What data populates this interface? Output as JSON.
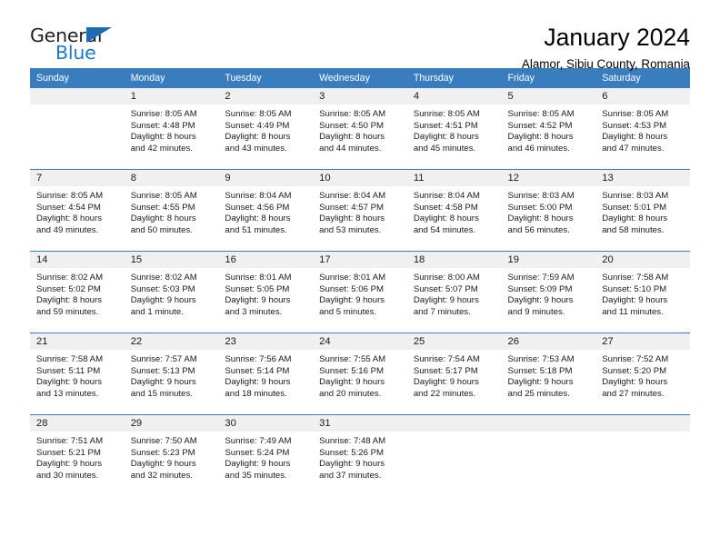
{
  "brand": {
    "name_part1": "General",
    "name_part2": "Blue",
    "accent_color": "#1f77c2",
    "header_color": "#3a7dbf"
  },
  "header": {
    "title": "January 2024",
    "subtitle": "Alamor, Sibiu County, Romania"
  },
  "weekday_headers": [
    "Sunday",
    "Monday",
    "Tuesday",
    "Wednesday",
    "Thursday",
    "Friday",
    "Saturday"
  ],
  "weeks": [
    [
      {
        "day": "",
        "sunrise": "",
        "sunset": "",
        "daylight_line1": "",
        "daylight_line2": "",
        "empty": true
      },
      {
        "day": "1",
        "sunrise": "Sunrise: 8:05 AM",
        "sunset": "Sunset: 4:48 PM",
        "daylight_line1": "Daylight: 8 hours",
        "daylight_line2": "and 42 minutes."
      },
      {
        "day": "2",
        "sunrise": "Sunrise: 8:05 AM",
        "sunset": "Sunset: 4:49 PM",
        "daylight_line1": "Daylight: 8 hours",
        "daylight_line2": "and 43 minutes."
      },
      {
        "day": "3",
        "sunrise": "Sunrise: 8:05 AM",
        "sunset": "Sunset: 4:50 PM",
        "daylight_line1": "Daylight: 8 hours",
        "daylight_line2": "and 44 minutes."
      },
      {
        "day": "4",
        "sunrise": "Sunrise: 8:05 AM",
        "sunset": "Sunset: 4:51 PM",
        "daylight_line1": "Daylight: 8 hours",
        "daylight_line2": "and 45 minutes."
      },
      {
        "day": "5",
        "sunrise": "Sunrise: 8:05 AM",
        "sunset": "Sunset: 4:52 PM",
        "daylight_line1": "Daylight: 8 hours",
        "daylight_line2": "and 46 minutes."
      },
      {
        "day": "6",
        "sunrise": "Sunrise: 8:05 AM",
        "sunset": "Sunset: 4:53 PM",
        "daylight_line1": "Daylight: 8 hours",
        "daylight_line2": "and 47 minutes."
      }
    ],
    [
      {
        "day": "7",
        "sunrise": "Sunrise: 8:05 AM",
        "sunset": "Sunset: 4:54 PM",
        "daylight_line1": "Daylight: 8 hours",
        "daylight_line2": "and 49 minutes."
      },
      {
        "day": "8",
        "sunrise": "Sunrise: 8:05 AM",
        "sunset": "Sunset: 4:55 PM",
        "daylight_line1": "Daylight: 8 hours",
        "daylight_line2": "and 50 minutes."
      },
      {
        "day": "9",
        "sunrise": "Sunrise: 8:04 AM",
        "sunset": "Sunset: 4:56 PM",
        "daylight_line1": "Daylight: 8 hours",
        "daylight_line2": "and 51 minutes."
      },
      {
        "day": "10",
        "sunrise": "Sunrise: 8:04 AM",
        "sunset": "Sunset: 4:57 PM",
        "daylight_line1": "Daylight: 8 hours",
        "daylight_line2": "and 53 minutes."
      },
      {
        "day": "11",
        "sunrise": "Sunrise: 8:04 AM",
        "sunset": "Sunset: 4:58 PM",
        "daylight_line1": "Daylight: 8 hours",
        "daylight_line2": "and 54 minutes."
      },
      {
        "day": "12",
        "sunrise": "Sunrise: 8:03 AM",
        "sunset": "Sunset: 5:00 PM",
        "daylight_line1": "Daylight: 8 hours",
        "daylight_line2": "and 56 minutes."
      },
      {
        "day": "13",
        "sunrise": "Sunrise: 8:03 AM",
        "sunset": "Sunset: 5:01 PM",
        "daylight_line1": "Daylight: 8 hours",
        "daylight_line2": "and 58 minutes."
      }
    ],
    [
      {
        "day": "14",
        "sunrise": "Sunrise: 8:02 AM",
        "sunset": "Sunset: 5:02 PM",
        "daylight_line1": "Daylight: 8 hours",
        "daylight_line2": "and 59 minutes."
      },
      {
        "day": "15",
        "sunrise": "Sunrise: 8:02 AM",
        "sunset": "Sunset: 5:03 PM",
        "daylight_line1": "Daylight: 9 hours",
        "daylight_line2": "and 1 minute."
      },
      {
        "day": "16",
        "sunrise": "Sunrise: 8:01 AM",
        "sunset": "Sunset: 5:05 PM",
        "daylight_line1": "Daylight: 9 hours",
        "daylight_line2": "and 3 minutes."
      },
      {
        "day": "17",
        "sunrise": "Sunrise: 8:01 AM",
        "sunset": "Sunset: 5:06 PM",
        "daylight_line1": "Daylight: 9 hours",
        "daylight_line2": "and 5 minutes."
      },
      {
        "day": "18",
        "sunrise": "Sunrise: 8:00 AM",
        "sunset": "Sunset: 5:07 PM",
        "daylight_line1": "Daylight: 9 hours",
        "daylight_line2": "and 7 minutes."
      },
      {
        "day": "19",
        "sunrise": "Sunrise: 7:59 AM",
        "sunset": "Sunset: 5:09 PM",
        "daylight_line1": "Daylight: 9 hours",
        "daylight_line2": "and 9 minutes."
      },
      {
        "day": "20",
        "sunrise": "Sunrise: 7:58 AM",
        "sunset": "Sunset: 5:10 PM",
        "daylight_line1": "Daylight: 9 hours",
        "daylight_line2": "and 11 minutes."
      }
    ],
    [
      {
        "day": "21",
        "sunrise": "Sunrise: 7:58 AM",
        "sunset": "Sunset: 5:11 PM",
        "daylight_line1": "Daylight: 9 hours",
        "daylight_line2": "and 13 minutes."
      },
      {
        "day": "22",
        "sunrise": "Sunrise: 7:57 AM",
        "sunset": "Sunset: 5:13 PM",
        "daylight_line1": "Daylight: 9 hours",
        "daylight_line2": "and 15 minutes."
      },
      {
        "day": "23",
        "sunrise": "Sunrise: 7:56 AM",
        "sunset": "Sunset: 5:14 PM",
        "daylight_line1": "Daylight: 9 hours",
        "daylight_line2": "and 18 minutes."
      },
      {
        "day": "24",
        "sunrise": "Sunrise: 7:55 AM",
        "sunset": "Sunset: 5:16 PM",
        "daylight_line1": "Daylight: 9 hours",
        "daylight_line2": "and 20 minutes."
      },
      {
        "day": "25",
        "sunrise": "Sunrise: 7:54 AM",
        "sunset": "Sunset: 5:17 PM",
        "daylight_line1": "Daylight: 9 hours",
        "daylight_line2": "and 22 minutes."
      },
      {
        "day": "26",
        "sunrise": "Sunrise: 7:53 AM",
        "sunset": "Sunset: 5:18 PM",
        "daylight_line1": "Daylight: 9 hours",
        "daylight_line2": "and 25 minutes."
      },
      {
        "day": "27",
        "sunrise": "Sunrise: 7:52 AM",
        "sunset": "Sunset: 5:20 PM",
        "daylight_line1": "Daylight: 9 hours",
        "daylight_line2": "and 27 minutes."
      }
    ],
    [
      {
        "day": "28",
        "sunrise": "Sunrise: 7:51 AM",
        "sunset": "Sunset: 5:21 PM",
        "daylight_line1": "Daylight: 9 hours",
        "daylight_line2": "and 30 minutes."
      },
      {
        "day": "29",
        "sunrise": "Sunrise: 7:50 AM",
        "sunset": "Sunset: 5:23 PM",
        "daylight_line1": "Daylight: 9 hours",
        "daylight_line2": "and 32 minutes."
      },
      {
        "day": "30",
        "sunrise": "Sunrise: 7:49 AM",
        "sunset": "Sunset: 5:24 PM",
        "daylight_line1": "Daylight: 9 hours",
        "daylight_line2": "and 35 minutes."
      },
      {
        "day": "31",
        "sunrise": "Sunrise: 7:48 AM",
        "sunset": "Sunset: 5:26 PM",
        "daylight_line1": "Daylight: 9 hours",
        "daylight_line2": "and 37 minutes."
      },
      {
        "day": "",
        "sunrise": "",
        "sunset": "",
        "daylight_line1": "",
        "daylight_line2": "",
        "empty": true
      },
      {
        "day": "",
        "sunrise": "",
        "sunset": "",
        "daylight_line1": "",
        "daylight_line2": "",
        "empty": true
      },
      {
        "day": "",
        "sunrise": "",
        "sunset": "",
        "daylight_line1": "",
        "daylight_line2": "",
        "empty": true
      }
    ]
  ]
}
